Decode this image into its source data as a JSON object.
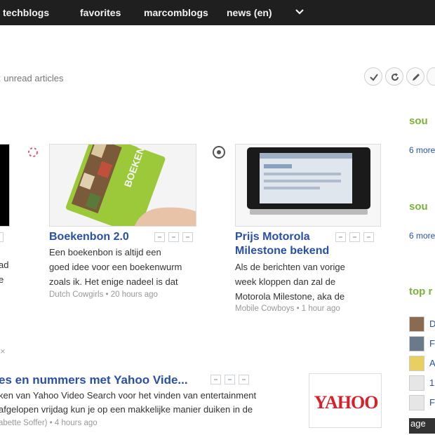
{
  "nav": {
    "items": [
      "techblogs",
      "favorites",
      "marcomblogs",
      "news (en)"
    ]
  },
  "toolbar": {
    "unread_label": "unread articles"
  },
  "cards": [
    {
      "title_line1": "Boekenbon 2.0",
      "title_line2": "",
      "snippet": [
        "Een boekenbon is altijd een",
        "goed idee voor een boekenwurm",
        "zoals ik. Het enige nadeel is dat"
      ],
      "meta": "Dutch Cowgirls • 20 hours ago"
    },
    {
      "title_line1": "Prijs Motorola",
      "title_line2": "Milestone bekend",
      "snippet": [
        "Als de berichten van vorige",
        "week kloppen dan zal de",
        "Motorola Milestone, aka de"
      ],
      "meta": "Mobile Cowboys • 1 hour ago"
    }
  ],
  "left_partial": {
    "snippet": [
      "ad",
      "e"
    ]
  },
  "list_item": {
    "title": "es en nummers met Yahoo Vide...",
    "snippet": [
      "ken van Yahoo Video Search voor het vinden van entertainment",
      "afgelopen vrijdag kun je op een makkelijke manier duiken in de"
    ],
    "meta": "abette Soffer) • 4 hours ago",
    "logo_text": "YAHOO"
  },
  "sidebar": {
    "section1_title": "sou",
    "section1_link": "6 more",
    "section2_title": "sou",
    "section2_link": "6 more",
    "section3_title": "top r",
    "letters": [
      "D",
      "F",
      "A",
      "1",
      "F"
    ],
    "bottom_text": "age"
  },
  "colors": {
    "topbar": "#1f1f1f",
    "link_blue": "#2a4fa8",
    "green": "#7ab23a",
    "yahoo_red": "#d6202a"
  }
}
